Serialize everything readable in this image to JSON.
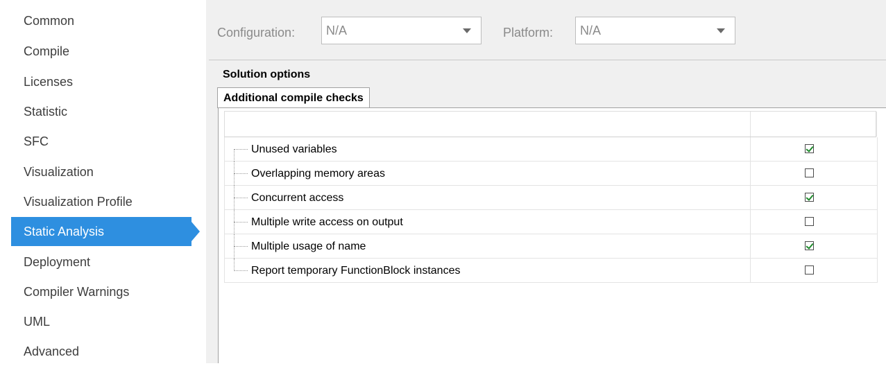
{
  "sidebar": {
    "items": [
      {
        "label": "Common",
        "active": false
      },
      {
        "label": "Compile",
        "active": false
      },
      {
        "label": "Licenses",
        "active": false
      },
      {
        "label": "Statistic",
        "active": false
      },
      {
        "label": "SFC",
        "active": false
      },
      {
        "label": "Visualization",
        "active": false
      },
      {
        "label": "Visualization Profile",
        "active": false
      },
      {
        "label": "Static Analysis",
        "active": true
      },
      {
        "label": "Deployment",
        "active": false
      },
      {
        "label": "Compiler Warnings",
        "active": false
      },
      {
        "label": "UML",
        "active": false
      },
      {
        "label": "Advanced",
        "active": false
      }
    ]
  },
  "config": {
    "configuration_label": "Configuration:",
    "configuration_value": "N/A",
    "platform_label": "Platform:",
    "platform_value": "N/A"
  },
  "solution": {
    "title": "Solution options",
    "tab_label": "Additional compile checks"
  },
  "checks": [
    {
      "label": "Unused variables",
      "checked": true
    },
    {
      "label": "Overlapping memory areas",
      "checked": false
    },
    {
      "label": "Concurrent access",
      "checked": true
    },
    {
      "label": "Multiple write access on output",
      "checked": false
    },
    {
      "label": "Multiple usage of name",
      "checked": true
    },
    {
      "label": "Report temporary FunctionBlock instances",
      "checked": false
    }
  ],
  "colors": {
    "active_bg": "#2e8fe0",
    "check": "#1f8a2c"
  }
}
